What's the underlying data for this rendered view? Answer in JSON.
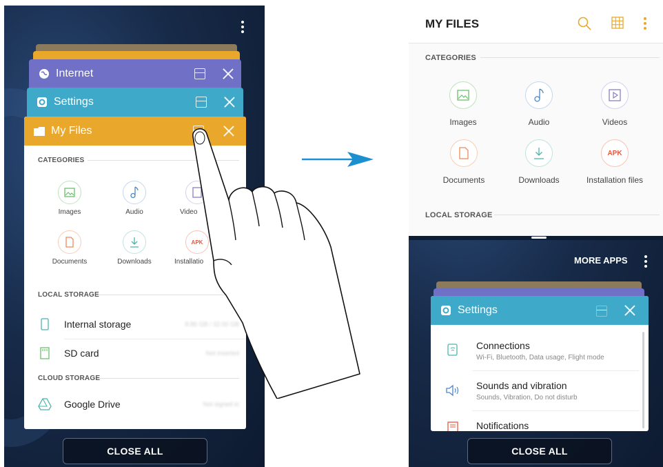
{
  "left_phone": {
    "cards": {
      "internet": {
        "title": "Internet",
        "color": "#6f70c6"
      },
      "settings": {
        "title": "Settings",
        "color": "#3ea9c8"
      },
      "myfiles": {
        "title": "My Files",
        "color": "#e9a82b"
      }
    },
    "categories_heading": "CATEGORIES",
    "categories": [
      {
        "label": "Images",
        "icon": "image-icon",
        "color": "#6abf69"
      },
      {
        "label": "Audio",
        "icon": "music-note-icon",
        "color": "#4f86c6"
      },
      {
        "label": "Video",
        "icon": "video-icon",
        "color": "#8a7fc7"
      },
      {
        "label": "Documents",
        "icon": "document-icon",
        "color": "#f08a54"
      },
      {
        "label": "Downloads",
        "icon": "download-icon",
        "color": "#4db3ad"
      },
      {
        "label": "Installatio",
        "icon": "apk-icon",
        "color": "#e9573f"
      }
    ],
    "local_storage_heading": "LOCAL STORAGE",
    "storage_items": [
      {
        "label": "Internal storage",
        "value": "8.86 GB / 32.00 GB",
        "icon": "phone-icon"
      },
      {
        "label": "SD card",
        "value": "Not inserted",
        "icon": "sd-card-icon"
      }
    ],
    "cloud_storage_heading": "CLOUD STORAGE",
    "cloud_items": [
      {
        "label": "Google Drive",
        "value": "Not signed in",
        "icon": "google-drive-icon"
      }
    ],
    "close_all": "CLOSE ALL"
  },
  "right_phone": {
    "top_app": {
      "title": "MY FILES",
      "accent": "#e9a82b",
      "categories_heading": "CATEGORIES",
      "categories": [
        {
          "label": "Images",
          "icon": "image-icon",
          "color": "#6abf69"
        },
        {
          "label": "Audio",
          "icon": "music-note-icon",
          "color": "#4f86c6"
        },
        {
          "label": "Videos",
          "icon": "video-icon",
          "color": "#8a7fc7"
        },
        {
          "label": "Documents",
          "icon": "document-icon",
          "color": "#f08a54"
        },
        {
          "label": "Downloads",
          "icon": "download-icon",
          "color": "#4db3ad"
        },
        {
          "label": "Installation files",
          "icon": "apk-icon",
          "color": "#e9573f"
        }
      ],
      "apk_text": "APK",
      "local_storage_heading": "LOCAL STORAGE"
    },
    "more_apps": "MORE APPS",
    "settings_card": {
      "title": "Settings",
      "color": "#3ea9c8",
      "items": [
        {
          "title": "Connections",
          "subtitle": "Wi-Fi, Bluetooth, Data usage, Flight mode",
          "icon": "connections-icon"
        },
        {
          "title": "Sounds and vibration",
          "subtitle": "Sounds, Vibration, Do not disturb",
          "icon": "speaker-icon"
        },
        {
          "title": "Notifications",
          "subtitle": "",
          "icon": "notifications-icon"
        }
      ]
    },
    "close_all": "CLOSE ALL"
  },
  "arrow_color": "#1b8fd0"
}
